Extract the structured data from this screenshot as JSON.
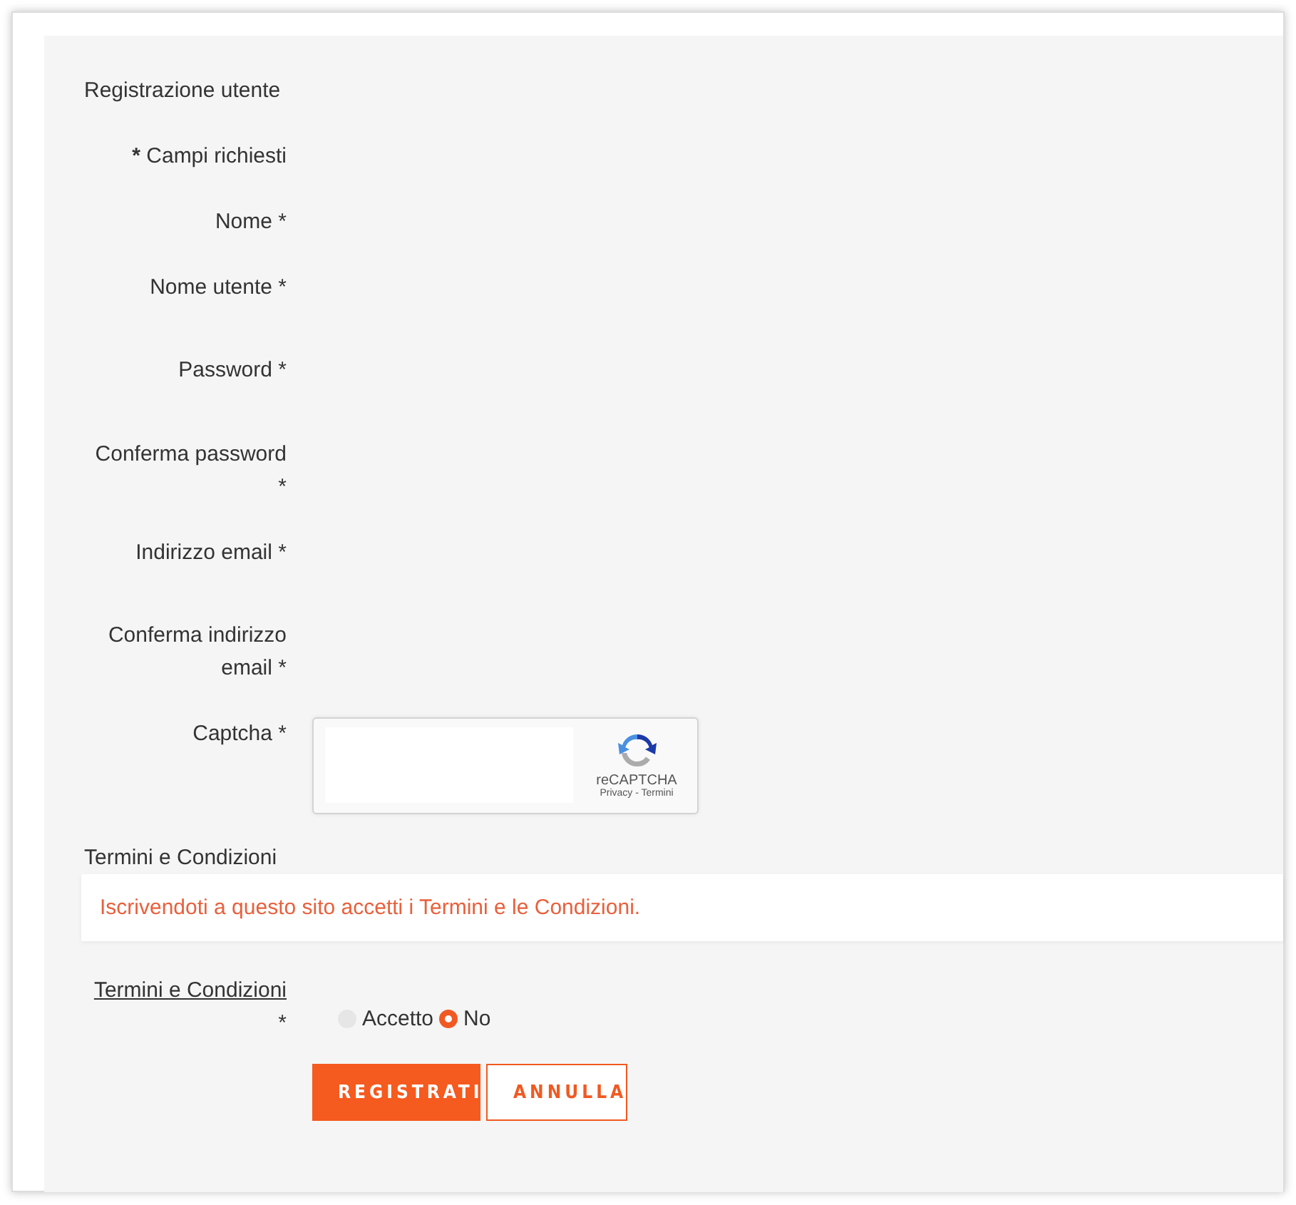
{
  "form": {
    "title": "Registrazione utente",
    "required_note": {
      "mark": "*",
      "text": "Campi richiesti"
    },
    "fields": [
      {
        "label": "Nome",
        "mark": "*"
      },
      {
        "label": "Nome utente",
        "mark": "*"
      },
      {
        "label": "Password",
        "mark": "*"
      },
      {
        "label": "Conferma password",
        "mark": "*"
      },
      {
        "label": "Indirizzo email",
        "mark": "*"
      },
      {
        "label": "Conferma indirizzo email",
        "mark": "*"
      }
    ],
    "captcha": {
      "label": "Captcha",
      "mark": "*",
      "brand": "reCAPTCHA",
      "links": "Privacy - Termini"
    },
    "terms": {
      "heading": "Termini e Condizioni",
      "notice": "Iscrivendoti a questo sito accetti i Termini e le Condizioni.",
      "label": "Termini e Condizioni",
      "mark": "*",
      "options": [
        {
          "label": "Accetto",
          "selected": false
        },
        {
          "label": "No",
          "selected": true
        }
      ]
    },
    "buttons": [
      {
        "label": "REGISTRATI",
        "kind": "primary"
      },
      {
        "label": "ANNULLA",
        "kind": "secondary"
      }
    ]
  }
}
